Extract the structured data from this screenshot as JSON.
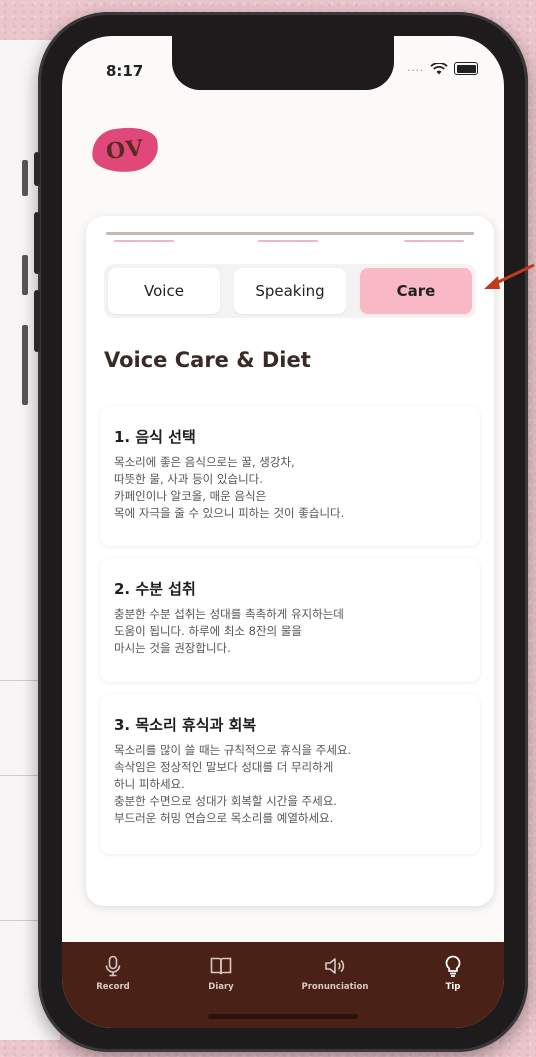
{
  "status": {
    "time": "8:17",
    "signal_dots": "...."
  },
  "logo": {
    "text": "OV"
  },
  "tabs": [
    {
      "label": "Voice",
      "active": false
    },
    {
      "label": "Speaking",
      "active": false
    },
    {
      "label": "Care",
      "active": true
    }
  ],
  "section_title": "Voice Care & Diet",
  "tips": [
    {
      "title": "1. 음식 선택",
      "body": "목소리에 좋은 음식으로는 꿀, 생강차,\n따뜻한 물, 사과 등이 있습니다.\n카페인이나 알코올, 매운 음식은\n목에 자극을 줄 수 있으니 피하는 것이 좋습니다."
    },
    {
      "title": "2. 수분 섭취",
      "body": "충분한 수분 섭취는 성대를 촉촉하게 유지하는데\n도움이 됩니다. 하루에 최소 8잔의 물을\n마시는 것을 권장합니다."
    },
    {
      "title": "3. 목소리 휴식과 회복",
      "body": "목소리를 많이 쓸 때는 규칙적으로 휴식을 주세요.\n속삭임은 정상적인 말보다 성대를 더 무리하게\n하니 피하세요.\n충분한 수면으로 성대가 회복할 시간을 주세요.\n부드러운 허밍 연습으로 목소리를 예열하세요."
    }
  ],
  "nav": [
    {
      "label": "Record",
      "icon": "microphone-icon"
    },
    {
      "label": "Diary",
      "icon": "book-icon"
    },
    {
      "label": "Pronunciation",
      "icon": "speaker-icon"
    },
    {
      "label": "Tip",
      "icon": "lightbulb-icon",
      "active": true
    }
  ],
  "colors": {
    "background": "#ebc6cd",
    "accent_pink": "#f8b8c6",
    "logo_pink": "#e0487a",
    "nav_brown": "#4a2116",
    "annotation_arrow": "#c23a1e"
  }
}
